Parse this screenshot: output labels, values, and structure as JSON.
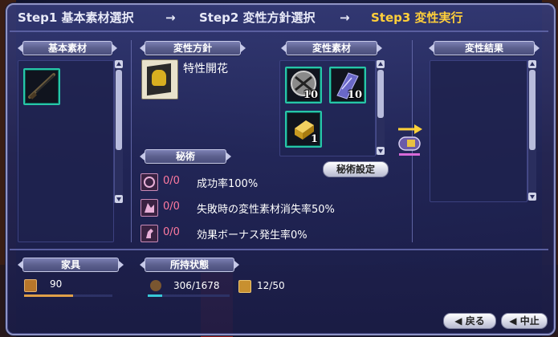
{
  "steps": {
    "step1": "Step1 基本素材選択",
    "step2": "Step2 変性方針選択",
    "step3": "Step3 変性実行",
    "arrow": "→"
  },
  "sections": {
    "base_material": "基本素材",
    "policy": "変性方針",
    "secret": "秘術",
    "material": "変性素材",
    "result": "変性結果",
    "furniture": "家具",
    "possession": "所持状態"
  },
  "policy": {
    "name": "特性開花",
    "icon": "book-icon"
  },
  "materials": [
    {
      "icon": "dagger-coin-icon",
      "count": "10"
    },
    {
      "icon": "cloth-scroll-icon",
      "count": "10"
    },
    {
      "icon": "gold-bar-icon",
      "count": "1"
    }
  ],
  "base_item_icon": "rifle-icon",
  "secret_button": "秘術設定",
  "effects": [
    {
      "icon": "circle-rune-icon",
      "count": "0/0",
      "text": "成功率100%"
    },
    {
      "icon": "wolf-howl-icon",
      "count": "0/0",
      "text": "失敗時の変性素材消失率50%"
    },
    {
      "icon": "horse-head-icon",
      "count": "0/0",
      "text": "効果ボーナス発生率0%"
    }
  ],
  "furniture": {
    "icon": "pouch-icon",
    "value": "90",
    "ratio": 0.55
  },
  "possession": {
    "weight": "306/1678",
    "weight_ratio": 0.18,
    "slots": "12/50",
    "weight_icon": "sack-icon",
    "slots_icon": "chest-icon"
  },
  "buttons": {
    "back": "◀ 戻る",
    "stop": "◀ 中止"
  },
  "colors": {
    "accent": "#ffcf3a",
    "slot_border": "#27c6a8",
    "effect_count": "#ff7aa0"
  }
}
